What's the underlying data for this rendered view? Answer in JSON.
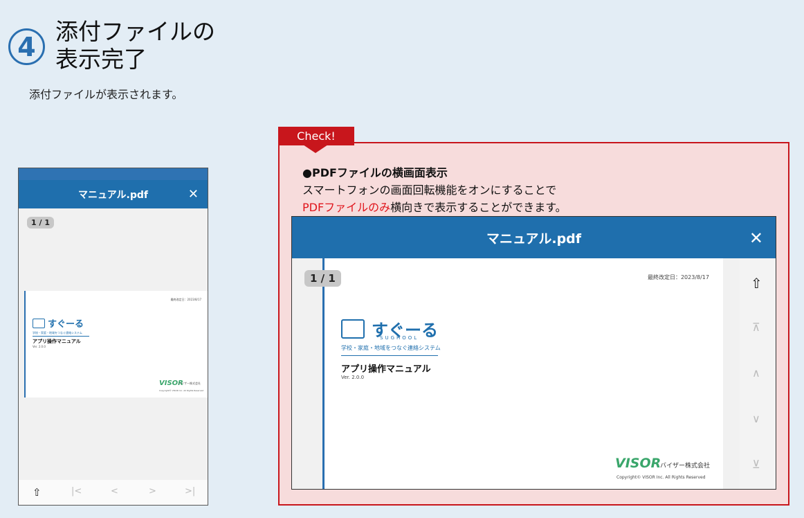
{
  "step": {
    "number": "4",
    "title_line1": "添付ファイルの",
    "title_line2": "表示完了",
    "description": "添付ファイルが表示されます。"
  },
  "viewer": {
    "title": "マニュアル.pdf",
    "close_label": "✕",
    "page_indicator": "1 / 1"
  },
  "document": {
    "date": "最終改定日：2023/8/17",
    "logo_text": "すぐーる",
    "logo_sub": "SUGHOOL",
    "tagline": "学校・家庭・地域をつなぐ連絡システム",
    "title": "アプリ操作マニュアル",
    "version": "Ver. 2.0.0",
    "company_logo": "VISOR",
    "company_name": "バイザー株式会社",
    "copyright": "Copyright© VISOR Inc. All Rights Reserved"
  },
  "phone_toolbar": {
    "share": "⇧",
    "first": "|<",
    "prev": "<",
    "next": ">",
    "last": ">|"
  },
  "landscape_side": {
    "share": "⇧",
    "first": "⊼",
    "prev": "∧",
    "next": "∨",
    "last": "⊻"
  },
  "check": {
    "tab_label": "Check!",
    "heading": "●PDFファイルの横画面表示",
    "line1": "スマートフォンの画面回転機能をオンにすることで",
    "line2_red": "PDFファイルのみ",
    "line2_rest": "横向きで表示することができます。"
  },
  "colors": {
    "accent": "#1f6fad",
    "check_red": "#c8161c",
    "check_bg": "#f7dcdc",
    "page_bg": "#e3edf5"
  }
}
